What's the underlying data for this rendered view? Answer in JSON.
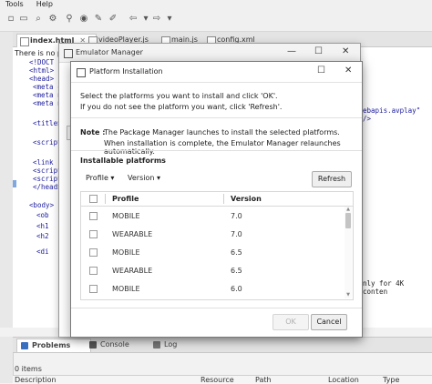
{
  "ide": {
    "menu": [
      "Tools",
      "Help"
    ],
    "tabs": [
      "index.html",
      "videoPlayer.js",
      "main.js",
      "config.xml"
    ],
    "notice": "There is no pr",
    "code_lines": [
      "<!DOCT",
      "<html>",
      "<head>",
      "<meta c",
      "<meta n",
      "<meta n",
      "<title>",
      "<script",
      "<link r",
      "<script",
      "<script",
      "</head>",
      "<body>",
      "<ob",
      "<h1",
      "<h2",
      "<di"
    ],
    "right_text_1": "ebapis.avplay\" />",
    "right_text_2": "nly for 4K conten",
    "bottom_tabs": [
      "Problems",
      "Console",
      "Log"
    ],
    "items_count": "0 items",
    "columns": [
      "Description",
      "Resource",
      "Path",
      "Location",
      "Type"
    ]
  },
  "emulator_manager": {
    "title": "Emulator Manager"
  },
  "platform_installation": {
    "title": "Platform Installation",
    "instruction_1": "Select the platforms you want to install and click 'OK'.",
    "instruction_2": "If you do not see the platform you want, click 'Refresh'.",
    "note_label": "Note :",
    "note_1": "The Package Manager launches to install the selected platforms.",
    "note_2": "When installation is complete, the Emulator Manager relaunches automatically.",
    "section_title": "Installable platforms",
    "profile_dropdown": "Profile",
    "version_dropdown": "Version",
    "refresh_button": "Refresh",
    "table_headers": [
      "Profile",
      "Version"
    ],
    "rows": [
      {
        "profile": "MOBILE",
        "version": "7.0"
      },
      {
        "profile": "WEARABLE",
        "version": "7.0"
      },
      {
        "profile": "MOBILE",
        "version": "6.5"
      },
      {
        "profile": "WEARABLE",
        "version": "6.5"
      },
      {
        "profile": "MOBILE",
        "version": "6.0"
      }
    ],
    "ok_button": "OK",
    "cancel_button": "Cancel"
  }
}
